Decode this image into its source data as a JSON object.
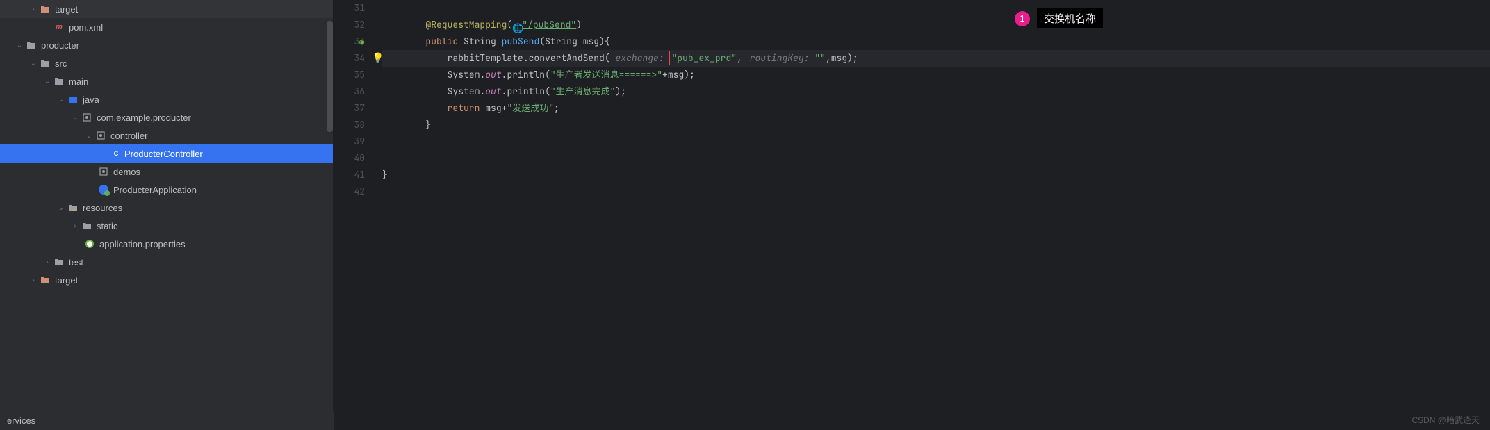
{
  "tree": {
    "items": [
      {
        "indent": 40,
        "chevron": "›",
        "icon": "orange-folder",
        "label": "target"
      },
      {
        "indent": 60,
        "chevron": "",
        "icon": "m-icon",
        "label": "pom.xml"
      },
      {
        "indent": 20,
        "chevron": "⌄",
        "icon": "folder",
        "label": "producter"
      },
      {
        "indent": 40,
        "chevron": "⌄",
        "icon": "folder",
        "label": "src"
      },
      {
        "indent": 60,
        "chevron": "⌄",
        "icon": "folder",
        "label": "main"
      },
      {
        "indent": 80,
        "chevron": "⌄",
        "icon": "blue-folder",
        "label": "java"
      },
      {
        "indent": 100,
        "chevron": "⌄",
        "icon": "pkg",
        "label": "com.example.producter"
      },
      {
        "indent": 120,
        "chevron": "⌄",
        "icon": "pkg",
        "label": "controller"
      },
      {
        "indent": 160,
        "chevron": "",
        "icon": "class",
        "label": "ProducterController",
        "selected": true
      },
      {
        "indent": 140,
        "chevron": "",
        "icon": "pkg",
        "label": "demos"
      },
      {
        "indent": 140,
        "chevron": "",
        "icon": "app-class",
        "label": "ProducterApplication"
      },
      {
        "indent": 80,
        "chevron": "⌄",
        "icon": "res-folder",
        "label": "resources"
      },
      {
        "indent": 100,
        "chevron": "›",
        "icon": "folder",
        "label": "static"
      },
      {
        "indent": 120,
        "chevron": "",
        "icon": "props",
        "label": "application.properties"
      },
      {
        "indent": 60,
        "chevron": "›",
        "icon": "folder",
        "label": "test"
      },
      {
        "indent": 40,
        "chevron": "›",
        "icon": "orange-folder",
        "label": "target"
      }
    ]
  },
  "bottomBar": "ervices",
  "lineNumbers": [
    "31",
    "32",
    "33",
    "34",
    "35",
    "36",
    "37",
    "38",
    "39",
    "40",
    "41",
    "42"
  ],
  "code": {
    "l32": {
      "annotation": "@RequestMapping",
      "path": "\"/pubSend\""
    },
    "l33": {
      "kw_public": "public",
      "type": "String",
      "method": "pubSend",
      "param_type": "String",
      "param_name": "msg"
    },
    "l34": {
      "obj": "rabbitTemplate",
      "call": ".convertAndSend(",
      "hint1": "exchange:",
      "arg1": "\"pub_ex_prd\"",
      "hint2": "routingKey:",
      "arg2": "\"\"",
      "arg3": ",msg);"
    },
    "l35": {
      "cls": "System",
      "out": "out",
      "call": ".println(",
      "str": "\"生产者发送消息======>\"",
      "rest": "+msg);"
    },
    "l36": {
      "cls": "System",
      "out": "out",
      "call": ".println(",
      "str": "\"生产消息完成\"",
      "rest": ");"
    },
    "l37": {
      "kw": "return",
      "rest": " msg+",
      "str": "\"发送成功\"",
      "end": ";"
    }
  },
  "annotation": {
    "num": "1",
    "text": "交换机名称"
  },
  "watermark": "CSDN @暗武逢天"
}
